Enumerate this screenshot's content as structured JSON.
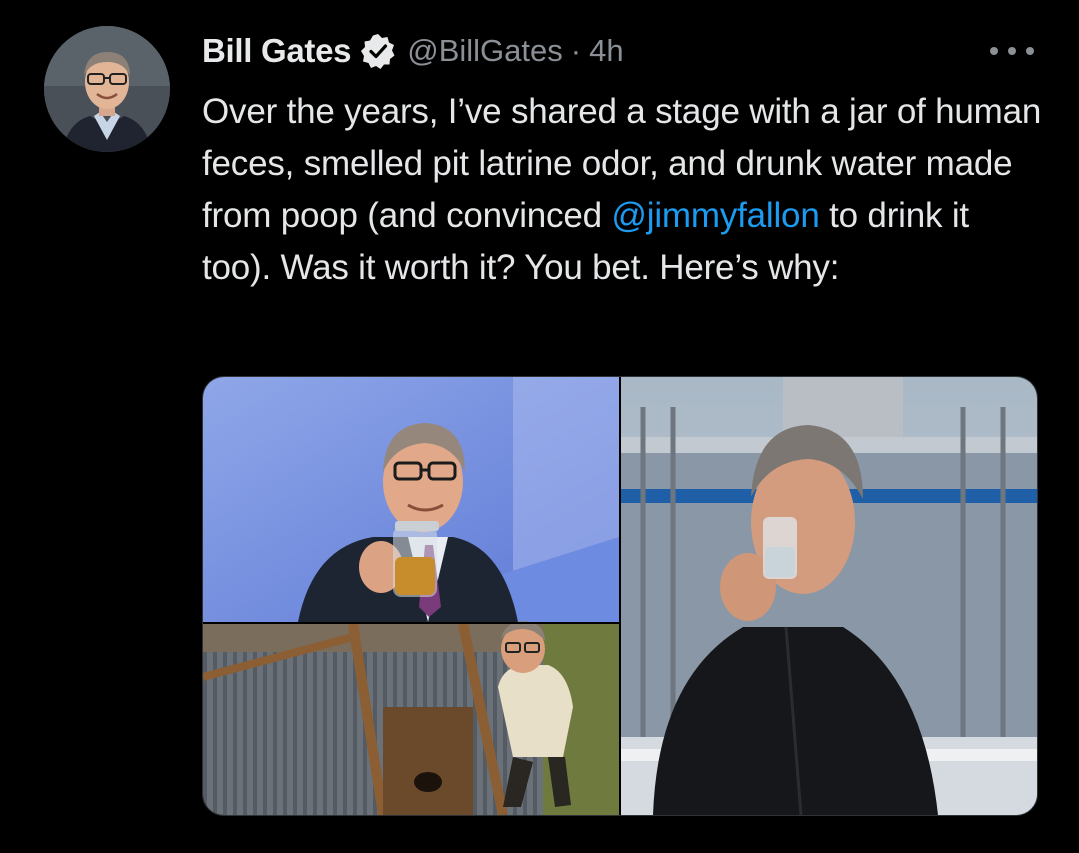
{
  "tweet": {
    "author": {
      "name": "Bill Gates",
      "handle": "@BillGates",
      "verified": true
    },
    "separator": "·",
    "time": "4h",
    "text_segments": [
      "Over the years, I’ve shared a stage with a jar of human feces, smelled pit latrine odor, and drunk water made from poop (and convinced ",
      "@jimmyfallon",
      " to drink it too). Was it worth it? You bet. Here’s why:"
    ],
    "media": [
      {
        "id": "photo-jar-stage"
      },
      {
        "id": "photo-latrine"
      },
      {
        "id": "photo-drinking-water"
      }
    ]
  },
  "icons": {
    "verified": "verified-badge-icon",
    "more": "more-options-icon"
  },
  "colors": {
    "background": "#000000",
    "text": "#e4e6e8",
    "secondary": "#8b9096",
    "link": "#1d9bf0"
  }
}
